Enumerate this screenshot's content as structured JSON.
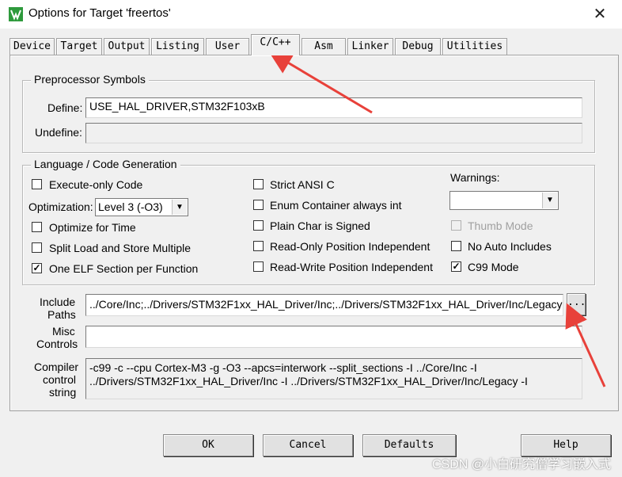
{
  "window": {
    "title": "Options for Target 'freertos'",
    "close_glyph": "✕"
  },
  "tabs": [
    "Device",
    "Target",
    "Output",
    "Listing",
    "User",
    "C/C++",
    "Asm",
    "Linker",
    "Debug",
    "Utilities"
  ],
  "preprocessor": {
    "group_title": "Preprocessor Symbols",
    "define_label": "Define:",
    "define_value": "USE_HAL_DRIVER,STM32F103xB",
    "undefine_label": "Undefine:",
    "undefine_value": ""
  },
  "language": {
    "group_title": "Language / Code Generation",
    "execute_only": {
      "label": "Execute-only Code",
      "checked": false
    },
    "optimization_label": "Optimization:",
    "optimization_value": "Level 3 (-O3)",
    "optimize_time": {
      "label": "Optimize for Time",
      "checked": false
    },
    "split_load": {
      "label": "Split Load and Store Multiple",
      "checked": false
    },
    "one_elf": {
      "label": "One ELF Section per Function",
      "checked": true
    },
    "strict_ansi": {
      "label": "Strict ANSI C",
      "checked": false
    },
    "enum_container": {
      "label": "Enum Container always int",
      "checked": false
    },
    "plain_char": {
      "label": "Plain Char is Signed",
      "checked": false
    },
    "ro_pos": {
      "label": "Read-Only Position Independent",
      "checked": false
    },
    "rw_pos": {
      "label": "Read-Write Position Independent",
      "checked": false
    },
    "warnings_label": "Warnings:",
    "warnings_value": "",
    "thumb_mode": {
      "label": "Thumb Mode",
      "checked": false
    },
    "no_auto_includes": {
      "label": "No Auto Includes",
      "checked": false
    },
    "c99_mode": {
      "label": "C99 Mode",
      "checked": true
    }
  },
  "include": {
    "label_line1": "Include",
    "label_line2": "Paths",
    "value": "../Core/Inc;../Drivers/STM32F1xx_HAL_Driver/Inc;../Drivers/STM32F1xx_HAL_Driver/Inc/Legacy;",
    "browse_label": "..."
  },
  "misc": {
    "label_line1": "Misc",
    "label_line2": "Controls",
    "value": ""
  },
  "compiler": {
    "label_line1": "Compiler",
    "label_line2": "control",
    "label_line3": "string",
    "line1": "-c99 -c --cpu Cortex-M3 -g -O3 --apcs=interwork --split_sections -I ../Core/Inc -I",
    "line2": "../Drivers/STM32F1xx_HAL_Driver/Inc -I ../Drivers/STM32F1xx_HAL_Driver/Inc/Legacy -I"
  },
  "buttons": {
    "ok": "OK",
    "cancel": "Cancel",
    "defaults": "Defaults",
    "help": "Help"
  },
  "watermark": "CSDN @小白研究僧学习嵌入式",
  "colors": {
    "annotation_arrow": "#e8413a",
    "app_icon": "#2e9a3c"
  }
}
